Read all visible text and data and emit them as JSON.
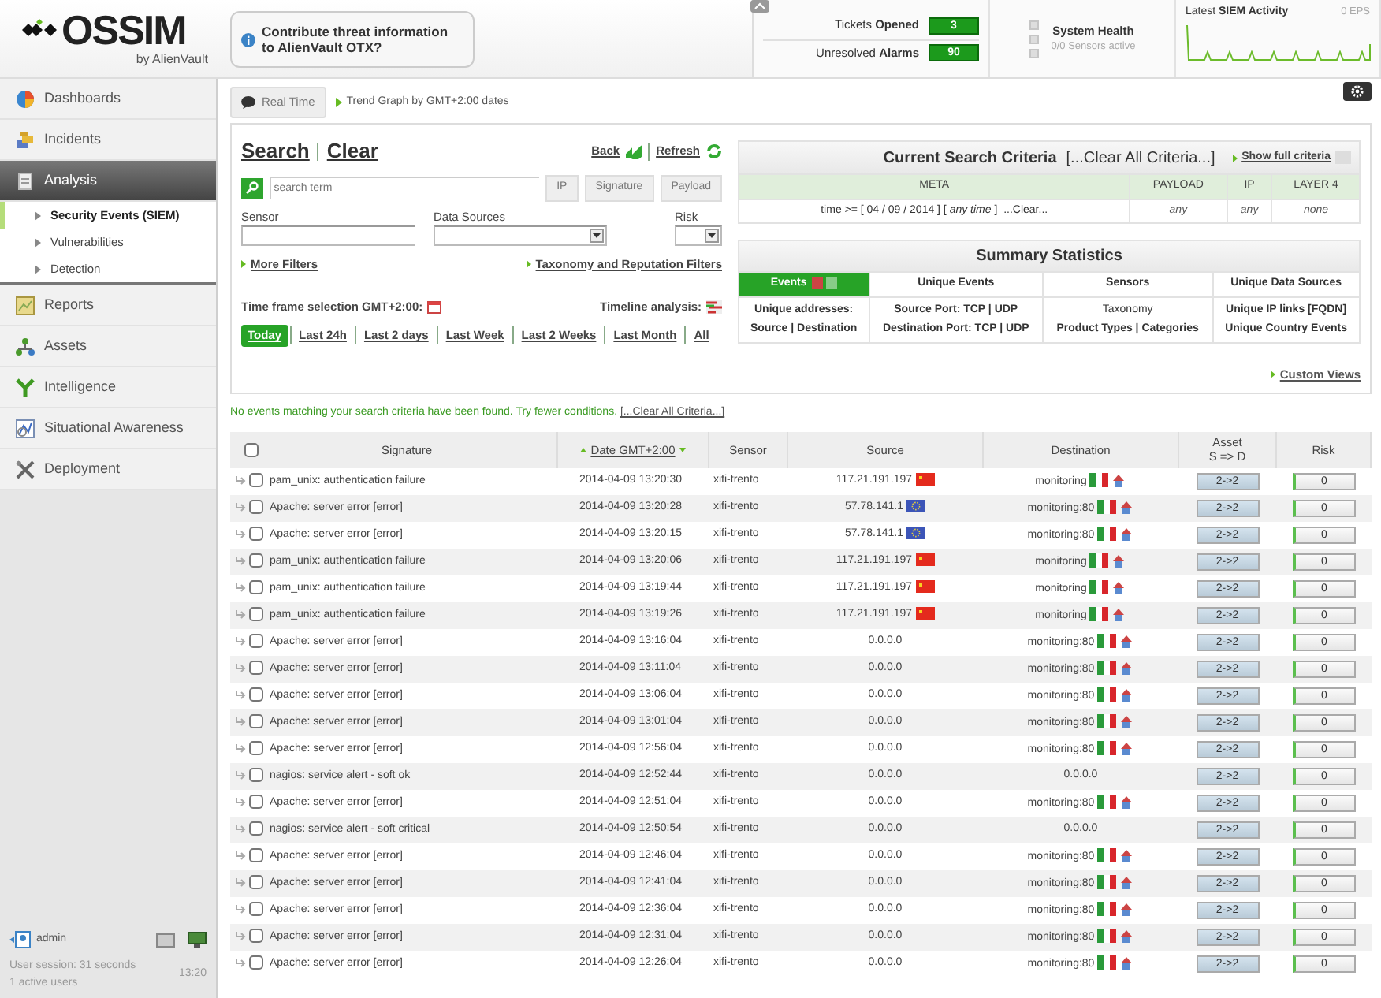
{
  "header": {
    "logo": "OSSIM",
    "logo_sub": "by AlienVault",
    "otx_prompt": "Contribute threat information to AlienVault OTX?",
    "tickets": {
      "label": "Tickets **Opened**",
      "count": "3"
    },
    "alarms": {
      "label": "Unresolved **Alarms**",
      "count": "90"
    },
    "system_health": {
      "title": "System Health",
      "sensors": "0/0 Sensors active"
    },
    "siem_activity": {
      "title": "Latest **SIEM Activity**",
      "eps": "0 EPS"
    }
  },
  "sidebar": {
    "items": [
      {
        "label": "Dashboards",
        "selected": false
      },
      {
        "label": "Incidents",
        "selected": false
      },
      {
        "label": "Analysis",
        "selected": true,
        "children": [
          {
            "label": "Security Events (SIEM)",
            "selected": true
          },
          {
            "label": "Vulnerabilities",
            "selected": false
          },
          {
            "label": "Detection",
            "selected": false
          }
        ]
      },
      {
        "label": "Reports",
        "selected": false
      },
      {
        "label": "Assets",
        "selected": false
      },
      {
        "label": "Intelligence",
        "selected": false
      },
      {
        "label": "Situational Awareness",
        "selected": false
      },
      {
        "label": "Deployment",
        "selected": false
      }
    ],
    "user": "admin",
    "session": "User session: 31 seconds",
    "active_users": "1 active users",
    "time": "13:20"
  },
  "toolbar": {
    "realtime": "Real Time",
    "trend_link": "Trend Graph by GMT+2:00 dates"
  },
  "search": {
    "title": "Search",
    "clear": "Clear",
    "back": "Back",
    "refresh": "Refresh",
    "placeholder": "search term",
    "buttons": [
      "IP",
      "Signature",
      "Payload"
    ],
    "filters": [
      {
        "label": "Sensor",
        "kind": "text"
      },
      {
        "label": "Data Sources",
        "kind": "select"
      },
      {
        "label": "Risk",
        "kind": "select"
      }
    ],
    "more_filters": "More Filters",
    "taxonomy": "Taxonomy and Reputation Filters",
    "timeframe": "Time frame selection GMT+2:00:",
    "timeline": "Timeline analysis:",
    "ranges": [
      {
        "label": "Today",
        "selected": true
      },
      {
        "label": "Last 24h",
        "selected": false
      },
      {
        "label": "Last 2 days",
        "selected": false
      },
      {
        "label": "Last Week",
        "selected": false
      },
      {
        "label": "Last 2 Weeks",
        "selected": false
      },
      {
        "label": "Last Month",
        "selected": false
      },
      {
        "label": "All",
        "selected": false
      }
    ]
  },
  "criteria": {
    "title": "Current Search Criteria",
    "clear_all": "[...Clear All Criteria...]",
    "show_full": "Show full criteria",
    "columns": [
      "META",
      "PAYLOAD",
      "IP",
      "LAYER 4"
    ],
    "values": [
      "time >= [ 04 / 09 / 2014 ] [ *any time* ]  ...Clear...",
      "any",
      "any",
      "none"
    ]
  },
  "summary": {
    "title": "Summary Statistics",
    "tabs": [
      {
        "label": "Events",
        "selected": true
      },
      {
        "label": "Unique Events",
        "selected": false
      },
      {
        "label": "Sensors",
        "selected": false
      },
      {
        "label": "Unique Data Sources",
        "selected": false
      }
    ],
    "links": [
      [
        {
          "text": "Unique addresses:",
          "bold": true
        },
        {
          "text": "Source | Destination",
          "bold": true
        }
      ],
      [
        {
          "text": "Source Port: TCP | UDP",
          "bold": true
        },
        {
          "text": "Destination Port: TCP | UDP",
          "bold": true
        }
      ],
      [
        {
          "text": "Taxonomy",
          "bold": false
        },
        {
          "text": "Product Types | Categories",
          "bold": true
        }
      ],
      [
        {
          "text": "Unique IP links [FQDN]",
          "bold": true
        },
        {
          "text": "Unique Country Events",
          "bold": true
        }
      ]
    ],
    "custom_views": "Custom Views"
  },
  "message": "No events matching your search criteria have been found. Try fewer conditions.",
  "message_link": "[...Clear All Criteria...]",
  "table": {
    "columns": [
      "Signature",
      "Date GMT+2:00",
      "Sensor",
      "Source",
      "Destination",
      "Asset",
      "Risk"
    ],
    "asset_sub": "S => D",
    "select_all_checked": false,
    "rows": [
      {
        "checked": false,
        "signature": "pam_unix: authentication failure",
        "date": "2014-04-09 13:20:30",
        "sensor": "xifi-trento",
        "source": "117.21.191.197",
        "source_country": {
          "kind": "cn"
        },
        "destination": "monitoring",
        "destination_country": {
          "kind": "it"
        },
        "asset": "2->2",
        "risk": "0"
      },
      {
        "checked": false,
        "signature": "Apache: server error [error]",
        "date": "2014-04-09 13:20:28",
        "sensor": "xifi-trento",
        "source": "57.78.141.1",
        "source_country": {
          "kind": "eu"
        },
        "destination": "monitoring:80",
        "destination_country": {
          "kind": "it"
        },
        "asset": "2->2",
        "risk": "0"
      },
      {
        "checked": false,
        "signature": "Apache: server error [error]",
        "date": "2014-04-09 13:20:15",
        "sensor": "xifi-trento",
        "source": "57.78.141.1",
        "source_country": {
          "kind": "eu"
        },
        "destination": "monitoring:80",
        "destination_country": {
          "kind": "it"
        },
        "asset": "2->2",
        "risk": "0"
      },
      {
        "checked": false,
        "signature": "pam_unix: authentication failure",
        "date": "2014-04-09 13:20:06",
        "sensor": "xifi-trento",
        "source": "117.21.191.197",
        "source_country": {
          "kind": "cn"
        },
        "destination": "monitoring",
        "destination_country": {
          "kind": "it"
        },
        "asset": "2->2",
        "risk": "0"
      },
      {
        "checked": false,
        "signature": "pam_unix: authentication failure",
        "date": "2014-04-09 13:19:44",
        "sensor": "xifi-trento",
        "source": "117.21.191.197",
        "source_country": {
          "kind": "cn"
        },
        "destination": "monitoring",
        "destination_country": {
          "kind": "it"
        },
        "asset": "2->2",
        "risk": "0"
      },
      {
        "checked": false,
        "signature": "pam_unix: authentication failure",
        "date": "2014-04-09 13:19:26",
        "sensor": "xifi-trento",
        "source": "117.21.191.197",
        "source_country": {
          "kind": "cn"
        },
        "destination": "monitoring",
        "destination_country": {
          "kind": "it"
        },
        "asset": "2->2",
        "risk": "0"
      },
      {
        "checked": false,
        "signature": "Apache: server error [error]",
        "date": "2014-04-09 13:16:04",
        "sensor": "xifi-trento",
        "source": "0.0.0.0",
        "destination": "monitoring:80",
        "destination_country": {
          "kind": "it"
        },
        "asset": "2->2",
        "risk": "0"
      },
      {
        "checked": false,
        "signature": "Apache: server error [error]",
        "date": "2014-04-09 13:11:04",
        "sensor": "xifi-trento",
        "source": "0.0.0.0",
        "destination": "monitoring:80",
        "destination_country": {
          "kind": "it"
        },
        "asset": "2->2",
        "risk": "0"
      },
      {
        "checked": false,
        "signature": "Apache: server error [error]",
        "date": "2014-04-09 13:06:04",
        "sensor": "xifi-trento",
        "source": "0.0.0.0",
        "destination": "monitoring:80",
        "destination_country": {
          "kind": "it"
        },
        "asset": "2->2",
        "risk": "0"
      },
      {
        "checked": false,
        "signature": "Apache: server error [error]",
        "date": "2014-04-09 13:01:04",
        "sensor": "xifi-trento",
        "source": "0.0.0.0",
        "destination": "monitoring:80",
        "destination_country": {
          "kind": "it"
        },
        "asset": "2->2",
        "risk": "0"
      },
      {
        "checked": false,
        "signature": "Apache: server error [error]",
        "date": "2014-04-09 12:56:04",
        "sensor": "xifi-trento",
        "source": "0.0.0.0",
        "destination": "monitoring:80",
        "destination_country": {
          "kind": "it"
        },
        "asset": "2->2",
        "risk": "0"
      },
      {
        "checked": false,
        "signature": "nagios: service alert - soft ok",
        "date": "2014-04-09 12:52:44",
        "sensor": "xifi-trento",
        "source": "0.0.0.0",
        "destination": "0.0.0.0",
        "asset": "2->2",
        "risk": "0"
      },
      {
        "checked": false,
        "signature": "Apache: server error [error]",
        "date": "2014-04-09 12:51:04",
        "sensor": "xifi-trento",
        "source": "0.0.0.0",
        "destination": "monitoring:80",
        "destination_country": {
          "kind": "it"
        },
        "asset": "2->2",
        "risk": "0"
      },
      {
        "checked": false,
        "signature": "nagios: service alert - soft critical",
        "date": "2014-04-09 12:50:54",
        "sensor": "xifi-trento",
        "source": "0.0.0.0",
        "destination": "0.0.0.0",
        "asset": "2->2",
        "risk": "0"
      },
      {
        "checked": false,
        "signature": "Apache: server error [error]",
        "date": "2014-04-09 12:46:04",
        "sensor": "xifi-trento",
        "source": "0.0.0.0",
        "destination": "monitoring:80",
        "destination_country": {
          "kind": "it"
        },
        "asset": "2->2",
        "risk": "0"
      },
      {
        "checked": false,
        "signature": "Apache: server error [error]",
        "date": "2014-04-09 12:41:04",
        "sensor": "xifi-trento",
        "source": "0.0.0.0",
        "destination": "monitoring:80",
        "destination_country": {
          "kind": "it"
        },
        "asset": "2->2",
        "risk": "0"
      },
      {
        "checked": false,
        "signature": "Apache: server error [error]",
        "date": "2014-04-09 12:36:04",
        "sensor": "xifi-trento",
        "source": "0.0.0.0",
        "destination": "monitoring:80",
        "destination_country": {
          "kind": "it"
        },
        "asset": "2->2",
        "risk": "0"
      },
      {
        "checked": false,
        "signature": "Apache: server error [error]",
        "date": "2014-04-09 12:31:04",
        "sensor": "xifi-trento",
        "source": "0.0.0.0",
        "destination": "monitoring:80",
        "destination_country": {
          "kind": "it"
        },
        "asset": "2->2",
        "risk": "0"
      },
      {
        "checked": false,
        "signature": "Apache: server error [error]",
        "date": "2014-04-09 12:26:04",
        "sensor": "xifi-trento",
        "source": "0.0.0.0",
        "destination": "monitoring:80",
        "destination_country": {
          "kind": "it"
        },
        "asset": "2->2",
        "risk": "0"
      }
    ]
  }
}
